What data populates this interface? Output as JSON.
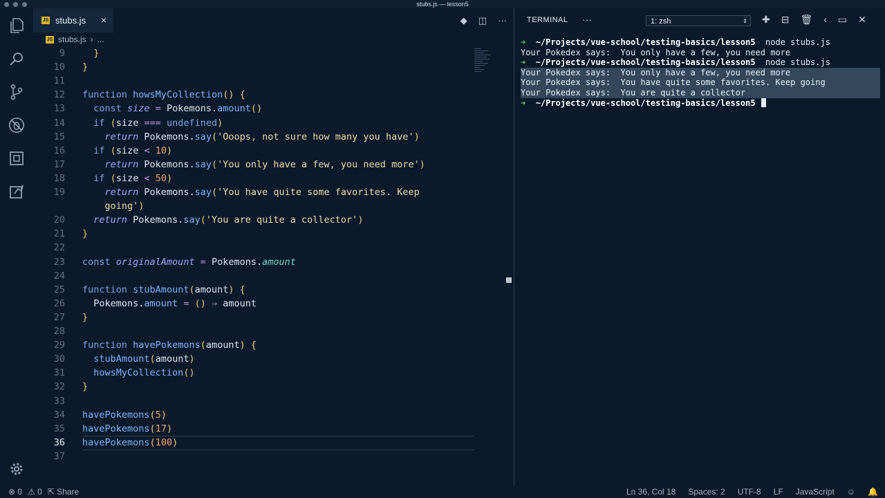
{
  "window": {
    "title": "stubs.js — lesson5"
  },
  "tab": {
    "label": "stubs.js",
    "badge": "JS",
    "close": "×"
  },
  "breadcrumb": {
    "file": "stubs.js",
    "sep": "›",
    "rest": "..."
  },
  "editor_actions": [
    "git-compare-icon",
    "split-editor-icon",
    "more-icon"
  ],
  "code_lines": [
    {
      "n": "9",
      "html": "  <span class='pun'>}</span>"
    },
    {
      "n": "10",
      "html": "<span class='pun'>}</span>"
    },
    {
      "n": "11",
      "html": ""
    },
    {
      "n": "12",
      "html": "<span class='kw'>function</span> <span class='fn'>howsMyCollection</span><span class='pun'>()</span> <span class='pun'>{</span>"
    },
    {
      "n": "13",
      "html": "  <span class='kw'>const</span> <span class='it'>size</span> <span class='op'>=</span> Pokemons.<span class='fn'>amount</span><span class='pun'>()</span>"
    },
    {
      "n": "14",
      "html": "  <span class='kw'>if</span> <span class='pun'>(</span>size <span class='op'>===</span> <span class='kw'>undefined</span><span class='pun'>)</span>"
    },
    {
      "n": "15",
      "html": "    <span class='ret'>return</span> Pokemons.<span class='fn'>say</span><span class='pun'>(</span><span class='str'>'Ooops, not sure how many you have'</span><span class='pun'>)</span>"
    },
    {
      "n": "16",
      "html": "  <span class='kw'>if</span> <span class='pun'>(</span>size <span class='op'>&lt;</span> <span class='num'>10</span><span class='pun'>)</span>"
    },
    {
      "n": "17",
      "html": "    <span class='ret'>return</span> Pokemons.<span class='fn'>say</span><span class='pun'>(</span><span class='str'>'You only have a few, you need more'</span><span class='pun'>)</span>"
    },
    {
      "n": "18",
      "html": "  <span class='kw'>if</span> <span class='pun'>(</span>size <span class='op'>&lt;</span> <span class='num'>50</span><span class='pun'>)</span>"
    },
    {
      "n": "19",
      "html": "    <span class='ret'>return</span> Pokemons.<span class='fn'>say</span><span class='pun'>(</span><span class='str'>'You have quite some favorites. Keep</span>"
    },
    {
      "n": "",
      "html": "    <span class='str'>going'</span><span class='pun'>)</span>"
    },
    {
      "n": "20",
      "html": "  <span class='ret'>return</span> Pokemons.<span class='fn'>say</span><span class='pun'>(</span><span class='str'>'You are quite a collector'</span><span class='pun'>)</span>"
    },
    {
      "n": "21",
      "html": "<span class='pun'>}</span>"
    },
    {
      "n": "22",
      "html": ""
    },
    {
      "n": "23",
      "html": "<span class='kw'>const</span> <span class='it'>originalAmount</span> <span class='op'>=</span> Pokemons.<span class='prop it'>amount</span>"
    },
    {
      "n": "24",
      "html": ""
    },
    {
      "n": "25",
      "html": "<span class='kw'>function</span> <span class='fn'>stubAmount</span><span class='pun'>(</span>amount<span class='pun'>)</span> <span class='pun'>{</span>"
    },
    {
      "n": "26",
      "html": "  Pokemons.<span class='fn'>amount</span> <span class='op'>=</span> <span class='pun'>()</span> <span class='op'>⇒</span> amount"
    },
    {
      "n": "27",
      "html": "<span class='pun'>}</span>"
    },
    {
      "n": "28",
      "html": ""
    },
    {
      "n": "29",
      "html": "<span class='kw'>function</span> <span class='fn'>havePokemons</span><span class='pun'>(</span>amount<span class='pun'>)</span> <span class='pun'>{</span>"
    },
    {
      "n": "30",
      "html": "  <span class='fn'>stubAmount</span><span class='pun'>(</span>amount<span class='pun'>)</span>"
    },
    {
      "n": "31",
      "html": "  <span class='fn'>howsMyCollection</span><span class='pun'>()</span>"
    },
    {
      "n": "32",
      "html": "<span class='pun'>}</span>"
    },
    {
      "n": "33",
      "html": ""
    },
    {
      "n": "34",
      "html": "<span class='fn'>havePokemons</span><span class='pun'>(</span><span class='num'>5</span><span class='pun'>)</span>"
    },
    {
      "n": "35",
      "html": "<span class='fn'>havePokemons</span><span class='pun'>(</span><span class='num'>17</span><span class='pun'>)</span>"
    },
    {
      "n": "36",
      "html": "<span class='fn'>havePokemons</span><span class='pun'>(</span><span class='num'>100</span><span class='pun'>)</span>",
      "active": true
    },
    {
      "n": "37",
      "html": ""
    }
  ],
  "terminal": {
    "tab_label": "TERMINAL",
    "more": "···",
    "shell_select": "1: zsh",
    "actions": [
      "add-terminal-icon",
      "split-terminal-icon",
      "trash-icon",
      "chevron-left-icon",
      "maximize-panel-icon",
      "close-panel-icon"
    ],
    "lines": [
      {
        "type": "prompt",
        "path": "~/Projects/vue-school/testing-basics/lesson5",
        "cmd": "node stubs.js"
      },
      {
        "type": "out",
        "text": "Your Pokedex says:  You only have a few, you need more"
      },
      {
        "type": "prompt",
        "path": "~/Projects/vue-school/testing-basics/lesson5",
        "cmd": "node stubs.js"
      },
      {
        "type": "out",
        "text": "Your Pokedex says:  You only have a few, you need more",
        "selected": true
      },
      {
        "type": "out",
        "text": "Your Pokedex says:  You have quite some favorites. Keep going",
        "selected": true
      },
      {
        "type": "out",
        "text": "Your Pokedex says:  You are quite a collector",
        "selected": true
      },
      {
        "type": "prompt",
        "path": "~/Projects/vue-school/testing-basics/lesson5",
        "cmd": "",
        "cursor": true
      }
    ]
  },
  "status": {
    "errors": "0",
    "warnings": "0",
    "share": "Share",
    "position": "Ln 36, Col 18",
    "spaces": "Spaces: 2",
    "encoding": "UTF-8",
    "eol": "LF",
    "language": "JavaScript"
  }
}
